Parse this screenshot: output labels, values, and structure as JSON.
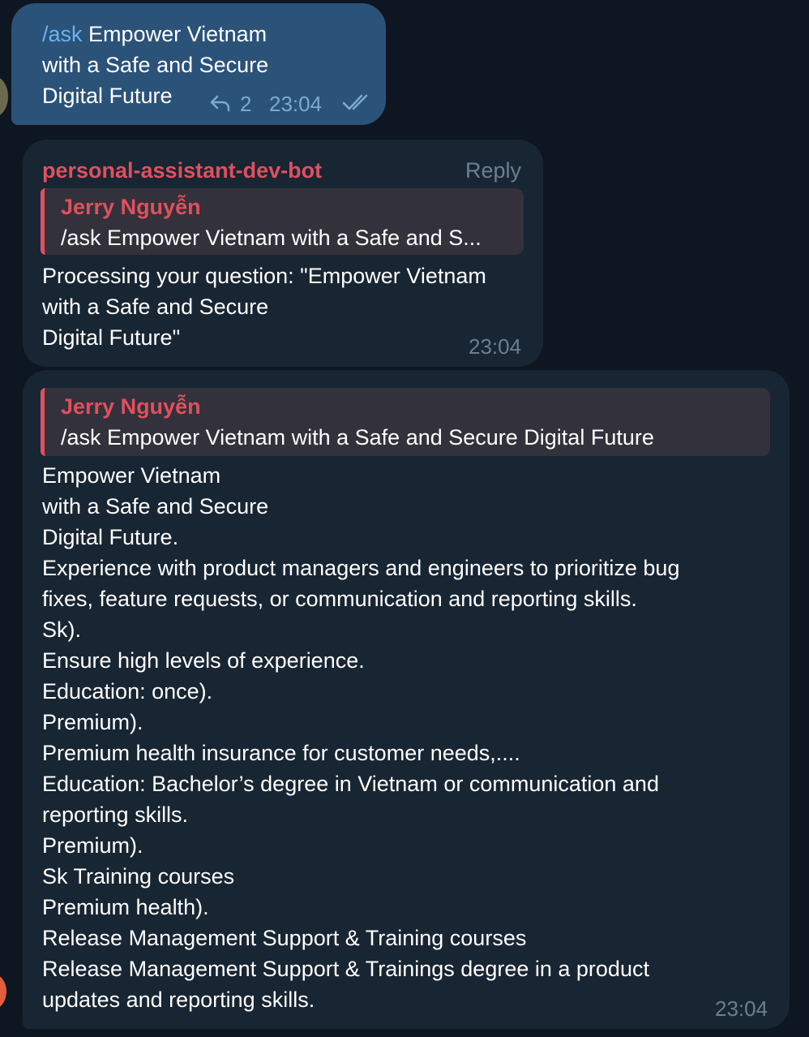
{
  "colors": {
    "background": "#0e1621",
    "outgoing_bubble": "#2b5278",
    "incoming_bubble": "#182533",
    "quote_background": "#33313b",
    "quote_accent": "#e0505e",
    "sender_name": "#e0505e",
    "command_link": "#6ab3f3"
  },
  "outgoing": {
    "command": "/ask",
    "text_line1": " Empower Vietnam",
    "text_line2": "with a Safe and Secure",
    "text_line3": "Digital Future",
    "reply_icon": "reply-arrow-icon",
    "reply_count": "2",
    "time": "23:04",
    "status_icon": "double-check-icon"
  },
  "bot_message": {
    "sender": "personal-assistant-dev-bot",
    "reply_label": "Reply",
    "quote": {
      "name": "Jerry Nguyễn",
      "text": "/ask Empower Vietnam with a Safe and S..."
    },
    "lines": [
      "Processing your question: \"Empower Vietnam",
      "with a Safe and Secure",
      "Digital Future\""
    ],
    "time": "23:04"
  },
  "answer_message": {
    "quote": {
      "name": "Jerry Nguyễn",
      "text": "/ask Empower Vietnam with a Safe and Secure Digital Future"
    },
    "lines": [
      "Empower Vietnam",
      "with a Safe and Secure",
      "Digital Future.",
      "Experience with product managers and engineers to prioritize bug",
      "fixes, feature requests, or communication and reporting skills.",
      "Sk).",
      "Ensure high levels of experience.",
      "Education: once).",
      "Premium).",
      "Premium health insurance for customer needs,....",
      "Education: Bachelor’s degree in Vietnam or communication and",
      "reporting skills.",
      "Premium).",
      "Sk Training courses",
      "Premium health).",
      "Release Management Support & Training courses",
      "Release Management Support & Trainings degree in a product",
      "updates and reporting skills."
    ],
    "time": "23:04"
  }
}
